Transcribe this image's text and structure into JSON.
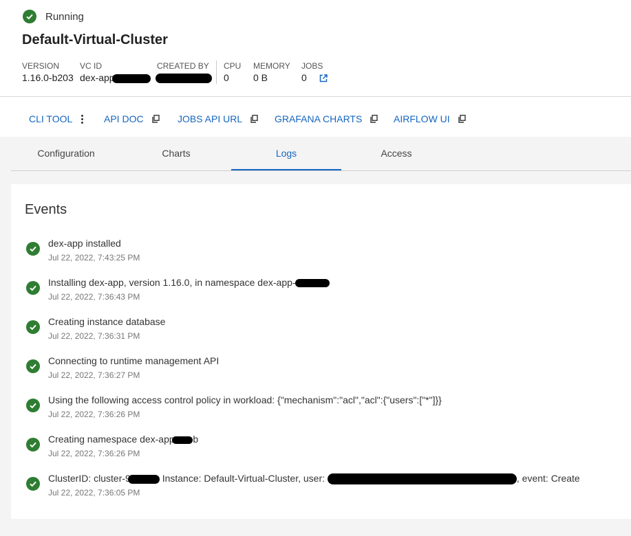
{
  "status": {
    "label": "Running",
    "color": "#2e7d32"
  },
  "cluster": {
    "title": "Default-Virtual-Cluster"
  },
  "meta": {
    "version": {
      "label": "VERSION",
      "value": "1.16.0-b203"
    },
    "vc_id": {
      "label": "VC ID",
      "value": "dex-app"
    },
    "created_by": {
      "label": "CREATED BY",
      "value": ""
    },
    "cpu": {
      "label": "CPU",
      "value": "0"
    },
    "memory": {
      "label": "MEMORY",
      "value": "0 B"
    },
    "jobs": {
      "label": "JOBS",
      "value": "0"
    }
  },
  "links": {
    "cli_tool": "CLI TOOL",
    "api_doc": "API DOC",
    "jobs_api_url": "JOBS API URL",
    "grafana_charts": "GRAFANA CHARTS",
    "airflow_ui": "AIRFLOW UI"
  },
  "tabs": [
    {
      "label": "Configuration"
    },
    {
      "label": "Charts"
    },
    {
      "label": "Logs",
      "active": true
    },
    {
      "label": "Access"
    }
  ],
  "events": {
    "title": "Events",
    "items": [
      {
        "message": "dex-app installed",
        "timestamp": "Jul 22, 2022, 7:43:25 PM"
      },
      {
        "message": "Installing dex-app, version 1.16.0, in namespace dex-app-",
        "timestamp": "Jul 22, 2022, 7:36:43 PM"
      },
      {
        "message": "Creating instance database",
        "timestamp": "Jul 22, 2022, 7:36:31 PM"
      },
      {
        "message": "Connecting to runtime management API",
        "timestamp": "Jul 22, 2022, 7:36:27 PM"
      },
      {
        "message": "Using the following access control policy in workload: {\"mechanism\":\"acl\",\"acl\":{\"users\":[\"*\"]}}",
        "timestamp": "Jul 22, 2022, 7:36:26 PM"
      },
      {
        "message": "Creating namespace dex-app-",
        "message_suffix": "b",
        "timestamp": "Jul 22, 2022, 7:36:26 PM"
      },
      {
        "message": "ClusterID: cluster-9",
        "message_mid": " Instance: Default-Virtual-Cluster, user: ",
        "message_suffix": ", event: Create",
        "timestamp": "Jul 22, 2022, 7:36:05 PM"
      }
    ]
  },
  "colors": {
    "accent": "#1565c0",
    "success": "#2e7d32"
  }
}
